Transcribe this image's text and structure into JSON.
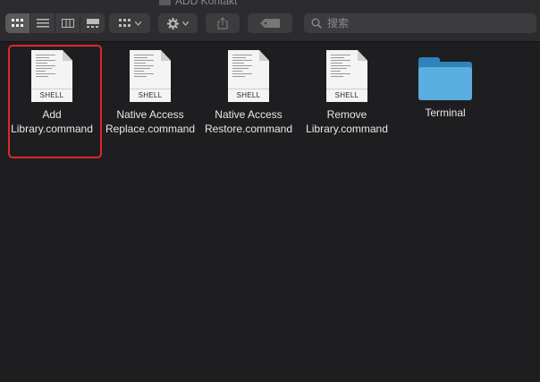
{
  "window": {
    "title": "ADD Kontakt"
  },
  "toolbar": {
    "view_buttons": [
      "icon-view",
      "list-view",
      "column-view",
      "gallery-view"
    ],
    "group_icon": "grid-icon",
    "action_icon": "gear-icon",
    "share_icon": "share-icon",
    "tag_icon": "tag-icon"
  },
  "search": {
    "placeholder": "搜索",
    "value": ""
  },
  "files": [
    {
      "label": "Add\nLibrary.command",
      "badge": "SHELL",
      "kind": "document",
      "selected": true
    },
    {
      "label": "Native Access\nReplace.command",
      "badge": "SHELL",
      "kind": "document"
    },
    {
      "label": "Native Access\nRestore.command",
      "badge": "SHELL",
      "kind": "document"
    },
    {
      "label": "Remove\nLibrary.command",
      "badge": "SHELL",
      "kind": "document"
    },
    {
      "label": "Terminal",
      "kind": "folder"
    }
  ],
  "colors": {
    "selection": "#e0262a",
    "folder": "#2f84bd",
    "background": "#1e1e20"
  }
}
